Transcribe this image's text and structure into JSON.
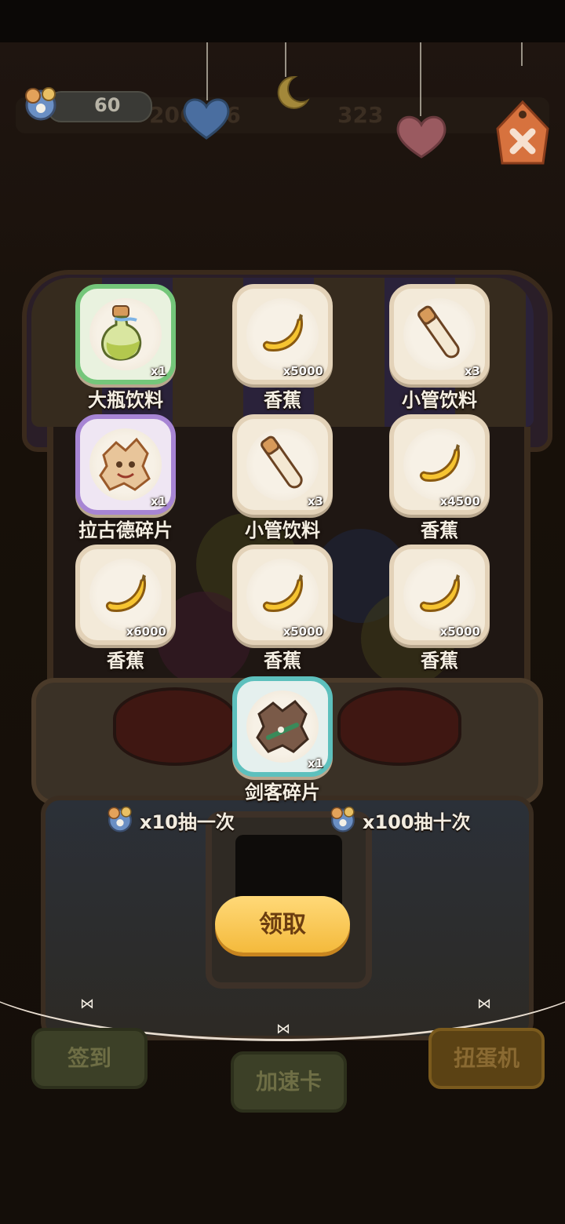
{
  "hud": {
    "coin_count": "60",
    "bg_count_1": "206486",
    "bg_count_2": "323"
  },
  "rewards": [
    {
      "name": "大瓶饮料",
      "qty": "x1",
      "icon": "big-bottle-drink-icon",
      "frame": "green"
    },
    {
      "name": "香蕉",
      "qty": "x5000",
      "icon": "banana-icon",
      "frame": "plain"
    },
    {
      "name": "小管饮料",
      "qty": "x3",
      "icon": "small-tube-drink-icon",
      "frame": "plain"
    },
    {
      "name": "拉古德碎片",
      "qty": "x1",
      "icon": "lagude-fragment-icon",
      "frame": "purple"
    },
    {
      "name": "小管饮料",
      "qty": "x3",
      "icon": "small-tube-drink-icon",
      "frame": "plain"
    },
    {
      "name": "香蕉",
      "qty": "x4500",
      "icon": "banana-icon",
      "frame": "plain"
    },
    {
      "name": "香蕉",
      "qty": "x6000",
      "icon": "banana-icon",
      "frame": "plain"
    },
    {
      "name": "香蕉",
      "qty": "x5000",
      "icon": "banana-icon",
      "frame": "plain"
    },
    {
      "name": "香蕉",
      "qty": "x5000",
      "icon": "banana-icon",
      "frame": "plain"
    },
    {
      "name": "剑客碎片",
      "qty": "x1",
      "icon": "swordsman-fragment-icon",
      "frame": "teal"
    }
  ],
  "draw": {
    "single": "x10抽一次",
    "ten": "x100抽十次"
  },
  "claim_label": "领取",
  "signs": {
    "checkin": "签到",
    "speedup": "加速卡",
    "gacha": "扭蛋机"
  },
  "colors": {
    "accent": "#f4ba3c",
    "green_frame": "#74c67a",
    "purple_frame": "#a785d4",
    "teal_frame": "#5dc0bd"
  }
}
